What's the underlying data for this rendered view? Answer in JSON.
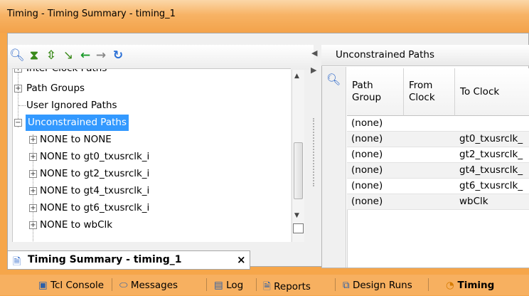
{
  "window": {
    "title": "Timing - Timing Summary - timing_1"
  },
  "toolbar": {
    "icons": [
      "search-icon",
      "collapse-all-icon",
      "expand-all-icon",
      "select-icon",
      "back-arrow-icon",
      "forward-arrow-icon",
      "refresh-icon"
    ]
  },
  "tree": {
    "items": [
      {
        "label": "Inter-Clock Paths",
        "level": 0,
        "expander": "+"
      },
      {
        "label": "Path Groups",
        "level": 0,
        "expander": "+"
      },
      {
        "label": "User Ignored Paths",
        "level": 0,
        "expander": ""
      },
      {
        "label": "Unconstrained Paths",
        "level": 0,
        "expander": "-",
        "selected": true
      },
      {
        "label": "NONE to NONE",
        "level": 1,
        "expander": "+"
      },
      {
        "label": "NONE to gt0_txusrclk_i",
        "level": 1,
        "expander": "+"
      },
      {
        "label": "NONE to gt2_txusrclk_i",
        "level": 1,
        "expander": "+"
      },
      {
        "label": "NONE to gt4_txusrclk_i",
        "level": 1,
        "expander": "+"
      },
      {
        "label": "NONE to gt6_txusrclk_i",
        "level": 1,
        "expander": "+"
      },
      {
        "label": "NONE to wbClk",
        "level": 1,
        "expander": "+"
      }
    ]
  },
  "right_panel": {
    "header": "Unconstrained Paths",
    "columns": [
      {
        "label": "Path\nGroup"
      },
      {
        "label": "From\nClock"
      },
      {
        "label": "To Clock"
      }
    ],
    "rows": [
      [
        "(none)",
        "",
        ""
      ],
      [
        "(none)",
        "",
        "gt0_txusrclk_"
      ],
      [
        "(none)",
        "",
        "gt2_txusrclk_"
      ],
      [
        "(none)",
        "",
        "gt4_txusrclk_"
      ],
      [
        "(none)",
        "",
        "gt6_txusrclk_"
      ],
      [
        "(none)",
        "",
        "wbClk"
      ]
    ]
  },
  "bottom_tab": {
    "label": "Timing Summary - timing_1",
    "close": "×"
  },
  "status_tabs": [
    {
      "label": "Tcl Console",
      "icon": "console-icon",
      "active": false
    },
    {
      "label": "Messages",
      "icon": "messages-icon",
      "active": false
    },
    {
      "label": "Log",
      "icon": "log-icon",
      "active": false
    },
    {
      "label": "Reports",
      "icon": "reports-icon",
      "active": false
    },
    {
      "label": "Design Runs",
      "icon": "design-runs-icon",
      "active": false
    },
    {
      "label": "Timing",
      "icon": "timing-icon",
      "active": true
    }
  ]
}
